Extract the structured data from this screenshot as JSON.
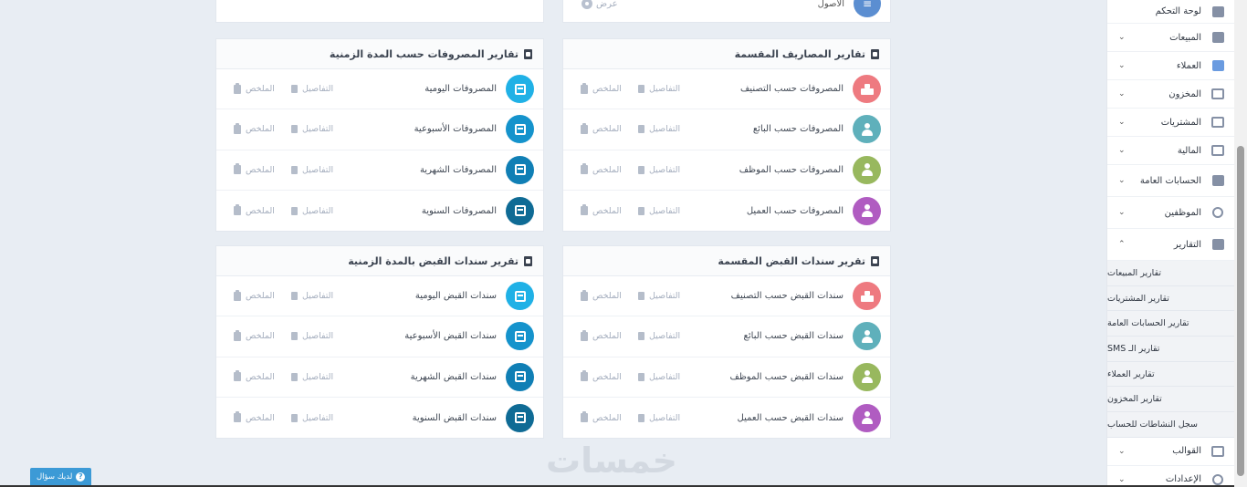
{
  "top_stub": {
    "left_title": "",
    "right_title": "الأصول",
    "right_action": "عرض"
  },
  "cards": {
    "expenses_divided": {
      "title": "تقارير المصاريف المقسمة",
      "rows": [
        {
          "name": "المصروفات حسب التصنيف",
          "details": "التفاصيل",
          "summary": "الملخص"
        },
        {
          "name": "المصروفات حسب البائع",
          "details": "التفاصيل",
          "summary": "الملخص"
        },
        {
          "name": "المصروفات حسب الموظف",
          "details": "التفاصيل",
          "summary": "الملخص"
        },
        {
          "name": "المصروفات حسب العميل",
          "details": "التفاصيل",
          "summary": "الملخص"
        }
      ]
    },
    "expenses_period": {
      "title": "تقارير المصروفات حسب المدة الزمنية",
      "rows": [
        {
          "name": "المصروفات اليومية",
          "details": "التفاصيل",
          "summary": "الملخص"
        },
        {
          "name": "المصروفات الأسبوعية",
          "details": "التفاصيل",
          "summary": "الملخص"
        },
        {
          "name": "المصروفات الشهرية",
          "details": "التفاصيل",
          "summary": "الملخص"
        },
        {
          "name": "المصروفات السنوية",
          "details": "التفاصيل",
          "summary": "الملخص"
        }
      ]
    },
    "receipts_divided": {
      "title": "تقرير سندات القبض المقسمة",
      "rows": [
        {
          "name": "سندات القبض حسب التصنيف",
          "details": "التفاصيل",
          "summary": "الملخص"
        },
        {
          "name": "سندات القبض حسب البائع",
          "details": "التفاصيل",
          "summary": "الملخص"
        },
        {
          "name": "سندات القبض حسب الموظف",
          "details": "التفاصيل",
          "summary": "الملخص"
        },
        {
          "name": "سندات القبض حسب العميل",
          "details": "التفاصيل",
          "summary": "الملخص"
        }
      ]
    },
    "receipts_period": {
      "title": "تقرير سندات القبض بالمدة الزمنية",
      "rows": [
        {
          "name": "سندات القبض اليومية",
          "details": "التفاصيل",
          "summary": "الملخص"
        },
        {
          "name": "سندات القبض الأسبوعية",
          "details": "التفاصيل",
          "summary": "الملخص"
        },
        {
          "name": "سندات القبض الشهرية",
          "details": "التفاصيل",
          "summary": "الملخص"
        },
        {
          "name": "سندات القبض السنوية",
          "details": "التفاصيل",
          "summary": "الملخص"
        }
      ]
    }
  },
  "sidebar": {
    "items": [
      {
        "label": "لوحة التحكم",
        "icon": "home-icon"
      },
      {
        "label": "المبيعات",
        "icon": "invoice-icon"
      },
      {
        "label": "العملاء",
        "icon": "customers-icon"
      },
      {
        "label": "المخزون",
        "icon": "box-icon"
      },
      {
        "label": "المشتريات",
        "icon": "truck-icon"
      },
      {
        "label": "المالية",
        "icon": "money-icon"
      },
      {
        "label": "الحسابات العامة",
        "icon": "cash-icon"
      },
      {
        "label": "الموظفين",
        "icon": "users-icon"
      },
      {
        "label": "التقارير",
        "icon": "chart-icon"
      }
    ],
    "sub_items": [
      "تقارير المبيعات",
      "تقارير المشتريات",
      "تقارير الحسابات العامة",
      "تقارير الـ SMS",
      "تقارير العملاء",
      "تقارير المخزون",
      "سجل النشاطات للحساب"
    ],
    "bottom_items": [
      {
        "label": "القوالب",
        "icon": "template-icon"
      },
      {
        "label": "الإعدادات",
        "icon": "settings-icon"
      }
    ]
  },
  "help_button": "لديك سؤال",
  "watermark": "خمسات",
  "colors": {
    "red": "#ee7a80",
    "teal": "#5fb0bb",
    "olive": "#98b85e",
    "purple": "#b05cc1",
    "sky": "#20b1e6",
    "blue2": "#1593cc",
    "blue3": "#107fb5",
    "blue4": "#0f6b95"
  }
}
